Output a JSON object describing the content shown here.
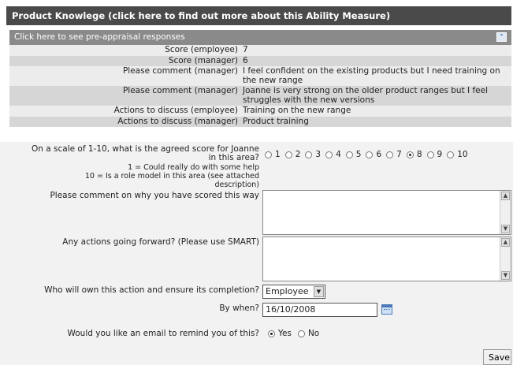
{
  "header": {
    "title": "Product Knowlege (click here to find out more about this Ability Measure)"
  },
  "preappraisal": {
    "toggle_label": "Click here to see pre-appraisal responses",
    "collapse_icon": "double-chevron-up-icon",
    "rows": [
      {
        "label": "Score (employee)",
        "value": "7"
      },
      {
        "label": "Score (manager)",
        "value": "6"
      },
      {
        "label": "Please comment (manager)",
        "value": "I feel confident on the existing products but I need training on the new range"
      },
      {
        "label": "Please comment (manager)",
        "value": "Joanne is very strong on the older product ranges but I feel struggles with the new versions"
      },
      {
        "label": "Actions to discuss (employee)",
        "value": "Training on the new range"
      },
      {
        "label": "Actions to discuss (manager)",
        "value": "Product training"
      }
    ]
  },
  "form": {
    "score_question_1": "On a scale of 1-10, what is the agreed score for Joanne",
    "score_question_2": "in this area?",
    "scale_hint_1": "1 = Could really do with some help",
    "scale_hint_2": "10 = Is a role model in this area (see attached",
    "scale_hint_3": "description)",
    "score_options": [
      "1",
      "2",
      "3",
      "4",
      "5",
      "6",
      "7",
      "8",
      "9",
      "10"
    ],
    "score_selected": "8",
    "comment_label": "Please comment on why you have scored this way",
    "comment_value": "",
    "actions_label": "Any actions going forward? (Please use SMART)",
    "actions_value": "",
    "owner_label": "Who will own this action and ensure its completion?",
    "owner_value": "Employee",
    "when_label": "By when?",
    "when_value": "16/10/2008",
    "email_label": "Would you like an email to remind you of this?",
    "email_yes": "Yes",
    "email_no": "No",
    "email_selected": "Yes",
    "save_label": "Save"
  }
}
